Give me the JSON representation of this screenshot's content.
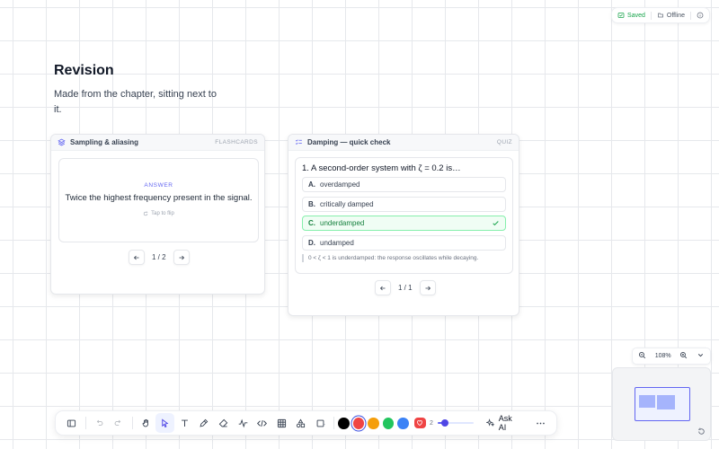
{
  "status": {
    "saved_label": "Saved",
    "offline_label": "Offline",
    "saved_icon": "cloud-check-icon",
    "offline_icon": "cloud-off-icon",
    "info_icon": "info-icon"
  },
  "document": {
    "title": "Revision",
    "subtitle": "Made from the chapter, sitting next to it."
  },
  "flashcards": {
    "title": "Sampling & aliasing",
    "kind": "FLASHCARDS",
    "icon": "layers-icon",
    "answer_label": "ANSWER",
    "answer": "Twice the highest frequency present in the signal.",
    "tap_hint": "Tap to flip",
    "pager": "1 / 2"
  },
  "quiz": {
    "title": "Damping — quick check",
    "kind": "QUIZ",
    "icon": "list-check-icon",
    "question": "1. A second-order system with ζ = 0.2 is…",
    "options": [
      {
        "letter": "A.",
        "text": "overdamped",
        "correct": false
      },
      {
        "letter": "B.",
        "text": "critically damped",
        "correct": false
      },
      {
        "letter": "C.",
        "text": "underdamped",
        "correct": true
      },
      {
        "letter": "D.",
        "text": "undamped",
        "correct": false
      }
    ],
    "explanation": "0 < ζ < 1 is underdamped: the response oscillates while decaying.",
    "pager": "1 / 1"
  },
  "zoom": {
    "level": "108%"
  },
  "toolbar": {
    "tools": [
      "sidebar-icon",
      "undo-icon",
      "redo-icon",
      "hand-icon",
      "pointer-icon",
      "text-icon",
      "pen-icon",
      "eraser-icon",
      "waveform-icon",
      "code-icon",
      "table-icon",
      "shapes-icon",
      "square-icon"
    ],
    "colors": [
      "#000000",
      "#ef4444",
      "#f59e0b",
      "#22c55e",
      "#3b82f6"
    ],
    "selected_color": "#ef4444",
    "stroke_width": "2",
    "opacity_percent": 20,
    "ask_ai_label": "Ask AI",
    "accent": "#6366f1"
  }
}
